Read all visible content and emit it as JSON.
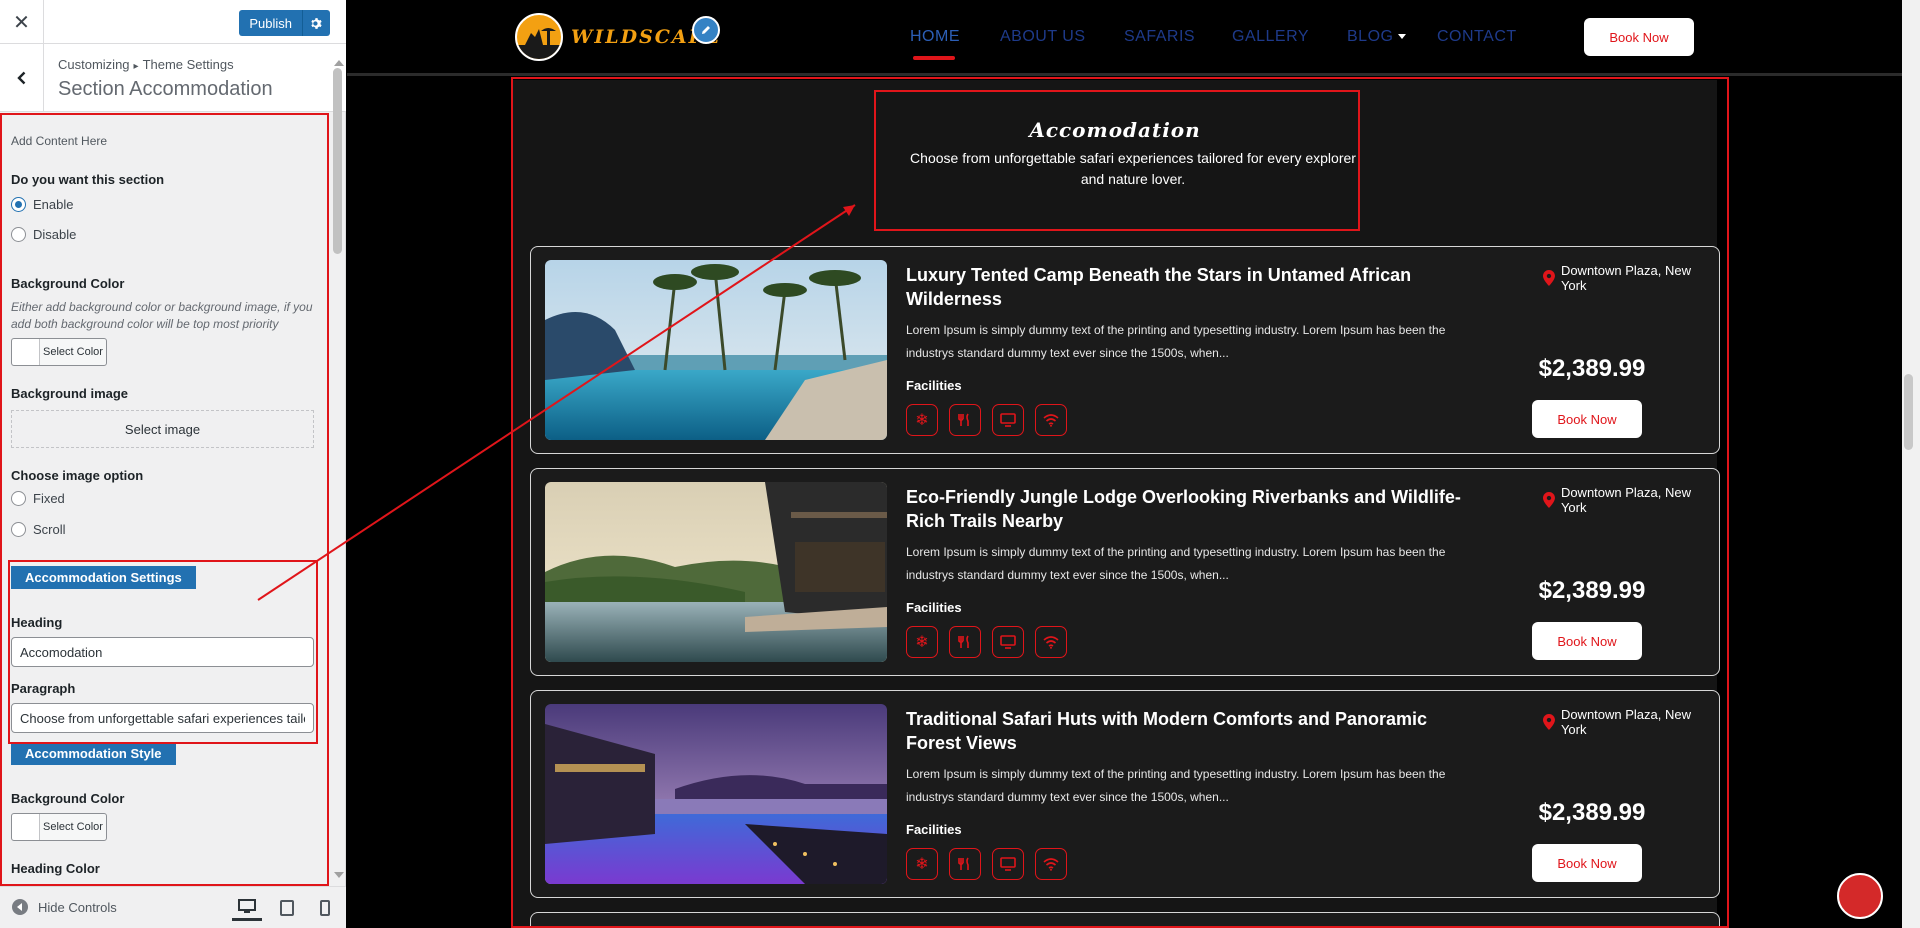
{
  "sidebar": {
    "close_icon": "close-icon",
    "publish_label": "Publish",
    "breadcrumb": {
      "part1": "Customizing",
      "separator": "▸",
      "part2": "Theme Settings"
    },
    "section_title": "Section Accommodation",
    "add_content": "Add Content Here",
    "want_section": {
      "label": "Do you want this section",
      "options": [
        "Enable",
        "Disable"
      ],
      "selected": "Enable"
    },
    "bg_color": {
      "label": "Background Color",
      "desc": "Either add background color or background image, if you add both background color will be top most priority",
      "button": "Select Color"
    },
    "bg_image": {
      "label": "Background image",
      "button": "Select image"
    },
    "image_option": {
      "label": "Choose image option",
      "options": [
        "Fixed",
        "Scroll"
      ]
    },
    "acc_settings_tag": "Accommodation Settings",
    "heading": {
      "label": "Heading",
      "value": "Accomodation"
    },
    "paragraph": {
      "label": "Paragraph",
      "value": "Choose from unforgettable safari experiences tailored for every explorer and nature lover."
    },
    "acc_style_tag": "Accommodation Style",
    "style_bg_color": {
      "label": "Background Color",
      "button": "Select Color"
    },
    "heading_color_label": "Heading Color",
    "hide_controls": "Hide Controls"
  },
  "preview": {
    "logo_text": "WILDSCAPE",
    "nav": [
      "HOME",
      "ABOUT US",
      "SAFARIS",
      "GALLERY",
      "BLOG",
      "CONTACT"
    ],
    "active_nav": "HOME",
    "book_now": "Book Now",
    "section": {
      "heading": "Accomodation",
      "paragraph": "Choose from unforgettable safari experiences tailored for every explorer and nature lover."
    },
    "cards": [
      {
        "title": "Luxury Tented Camp Beneath the Stars in Untamed African Wilderness",
        "text": "Lorem Ipsum is simply dummy text of the printing and typesetting industry. Lorem Ipsum has been the industrys standard dummy text ever since the 1500s, when...",
        "facilities_label": "Facilities",
        "location": "Downtown Plaza, New York",
        "price": "$2,389.99",
        "book": "Book Now"
      },
      {
        "title": "Eco-Friendly Jungle Lodge Overlooking Riverbanks and Wildlife-Rich Trails Nearby",
        "text": "Lorem Ipsum is simply dummy text of the printing and typesetting industry. Lorem Ipsum has been the industrys standard dummy text ever since the 1500s, when...",
        "facilities_label": "Facilities",
        "location": "Downtown Plaza, New York",
        "price": "$2,389.99",
        "book": "Book Now"
      },
      {
        "title": "Traditional Safari Huts with Modern Comforts and Panoramic Forest Views",
        "text": "Lorem Ipsum is simply dummy text of the printing and typesetting industry. Lorem Ipsum has been the industrys standard dummy text ever since the 1500s, when...",
        "facilities_label": "Facilities",
        "location": "Downtown Plaza, New York",
        "price": "$2,389.99",
        "book": "Book Now"
      }
    ],
    "facility_icons": [
      "snowflake-icon",
      "restaurant-icon",
      "tv-icon",
      "wifi-icon"
    ]
  },
  "colors": {
    "accent_red": "#e0151a",
    "wp_blue": "#2271b1",
    "nav_blue": "#1e3a8a",
    "logo_orange": "#f3a012"
  }
}
